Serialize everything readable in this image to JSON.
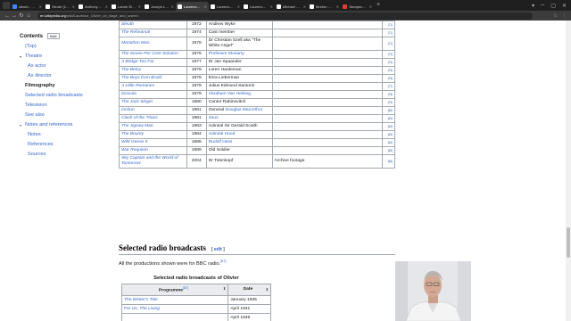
{
  "browser": {
    "tabs": [
      {
        "label": "sleuth - Google Поиск",
        "color": "#4285f4",
        "active": false
      },
      {
        "label": "Sleuth (1972 film) - Wikipedia",
        "color": "#ffffff",
        "active": false
      },
      {
        "label": "Anthony Shaffer (writer) - Wikipedia",
        "color": "#ffffff",
        "active": false
      },
      {
        "label": "Laurie Woodward - Wikipedia",
        "color": "#ffffff",
        "active": false
      },
      {
        "label": "Joseph L. Mankiewicz - Wikipedia",
        "color": "#ffffff",
        "active": false
      },
      {
        "label": "Laurence Olivier on stage and screen",
        "color": "#ffffff",
        "active": true
      },
      {
        "label": "Laurence Olivier on stage and screen",
        "color": "#ffffff",
        "active": false
      },
      {
        "label": "Laurence Olivier - Wikipedia",
        "color": "#ffffff",
        "active": false
      },
      {
        "label": "Michael Caine - Wikipedia",
        "color": "#ffffff",
        "active": false
      },
      {
        "label": "Morton Gottlieb - Wikipedia",
        "color": "#ffffff",
        "active": false
      },
      {
        "label": "Экспресс-панель",
        "color": "#e53935",
        "active": false
      }
    ],
    "new_tab": "+",
    "window_controls": [
      "▾",
      "─",
      "▢",
      "✕"
    ],
    "url_host": "en.wikipedia.org",
    "url_path": "/wiki/Laurence_Olivier_on_stage_and_screen",
    "nav": {
      "back": "←",
      "forward": "→",
      "reload": "↻",
      "home": "⌂"
    },
    "toolbar_icons": [
      "☆",
      "⋮"
    ]
  },
  "toc": {
    "title": "Contents",
    "hide_label": "hide",
    "items": [
      {
        "label": "(Top)",
        "level": 1,
        "expandable": false,
        "current": false
      },
      {
        "label": "Theatre",
        "level": 1,
        "expandable": true,
        "current": false
      },
      {
        "label": "As actor",
        "level": 2,
        "expandable": false,
        "current": false
      },
      {
        "label": "As director",
        "level": 2,
        "expandable": false,
        "current": false
      },
      {
        "label": "Filmography",
        "level": 1,
        "expandable": false,
        "current": true
      },
      {
        "label": "Selected radio broadcasts",
        "level": 1,
        "expandable": false,
        "current": false
      },
      {
        "label": "Television",
        "level": 1,
        "expandable": false,
        "current": false
      },
      {
        "label": "See also",
        "level": 1,
        "expandable": false,
        "current": false
      },
      {
        "label": "Notes and references",
        "level": 1,
        "expandable": true,
        "current": false
      },
      {
        "label": "Notes",
        "level": 2,
        "expandable": false,
        "current": false
      },
      {
        "label": "References",
        "level": 2,
        "expandable": false,
        "current": false
      },
      {
        "label": "Sources",
        "level": 2,
        "expandable": false,
        "current": false
      }
    ]
  },
  "film_rows": [
    {
      "title": "Sleuth",
      "year": "1972",
      "role": "Andrew Wyke",
      "role_link": false,
      "notes": "",
      "ref": "[71]"
    },
    {
      "title": "The Rehearsal",
      "year": "1974",
      "role": "Cast member",
      "role_link": false,
      "notes": "",
      "ref": "[71]"
    },
    {
      "title": "Marathon Man",
      "year": "1976",
      "role": "Dr Christian Szell aka \"The White Angel\"",
      "role_link": false,
      "notes": "",
      "ref": "[72]"
    },
    {
      "title": "The Seven-Per-Cent Solution",
      "year": "1976",
      "role": "Professor Moriarty",
      "role_link": true,
      "notes": "",
      "ref": "[73]"
    },
    {
      "title": "A Bridge Too Far",
      "year": "1977",
      "role": "Dr Jan Spaander",
      "role_link": false,
      "notes": "",
      "ref": "[74]"
    },
    {
      "title": "The Betsy",
      "year": "1978",
      "role": "Loren Hardeman",
      "role_link": false,
      "notes": "",
      "ref": "[75]"
    },
    {
      "title": "The Boys from Brazil",
      "year": "1978",
      "role": "Ezra Lieberman",
      "role_link": false,
      "notes": "",
      "ref": "[76]"
    },
    {
      "title": "A Little Romance",
      "year": "1979",
      "role": "Julius Edmond Santorin",
      "role_link": false,
      "notes": "",
      "ref": "[77]"
    },
    {
      "title": "Dracula",
      "year": "1979",
      "role": "Abraham Van Helsing",
      "role_link": true,
      "notes": "",
      "ref": "[78]"
    },
    {
      "title": "The Jazz Singer",
      "year": "1980",
      "role": "Cantor Rabinovitch",
      "role_link": false,
      "notes": "",
      "ref": "[79]"
    },
    {
      "title": "Inchon",
      "year": "1981",
      "role": "General Douglas MacArthur",
      "role_link": "partial",
      "role_plain": "General ",
      "role_linked": "Douglas MacArthur",
      "notes": "",
      "ref": "[80]"
    },
    {
      "title": "Clash of the Titans",
      "year": "1981",
      "role": "Zeus",
      "role_link": true,
      "notes": "",
      "ref": "[81]"
    },
    {
      "title": "The Jigsaw Man",
      "year": "1983",
      "role": "Admiral Sir Gerald Scaith",
      "role_link": false,
      "notes": "",
      "ref": "[82]"
    },
    {
      "title": "The Bounty",
      "year": "1984",
      "role": "Admiral Hood",
      "role_link": true,
      "notes": "",
      "ref": "[83]"
    },
    {
      "title": "Wild Geese II",
      "year": "1985",
      "role": "Rudolf Hess",
      "role_link": true,
      "notes": "",
      "ref": "[84]"
    },
    {
      "title": "War Requiem",
      "year": "1989",
      "role": "Old Soldier",
      "role_link": false,
      "notes": "",
      "ref": "[85]"
    },
    {
      "title": "Sky Captain and the World of Tomorrow",
      "year": "2004",
      "role": "Dr Totenkopf",
      "role_link": false,
      "notes": "Archive footage",
      "ref": "[86]"
    }
  ],
  "radio": {
    "heading": "Selected radio broadcasts",
    "edit_open": "[ ",
    "edit_label": "edit",
    "edit_close": " ]",
    "intro": "All the productions shown were for BBC radio.",
    "intro_ref": "[87]",
    "caption": "Selected radio broadcasts of Olivier",
    "col_programme": "Programme",
    "col_programme_ref": "[87]",
    "col_date": "Date",
    "sort_glyph": "⬍",
    "rows": [
      {
        "title": "The Winter's Tale",
        "date": "January 1935"
      },
      {
        "title": "For Us, The Living",
        "date": "April 1941"
      },
      {
        "title": "",
        "date": "April 1945"
      }
    ]
  },
  "colors": {
    "link": "#3366cc",
    "border": "#a2a9b1",
    "header_bg": "#eaecf0",
    "chrome_dark": "#1f1f1f",
    "chrome_mid": "#3c3c3c"
  }
}
